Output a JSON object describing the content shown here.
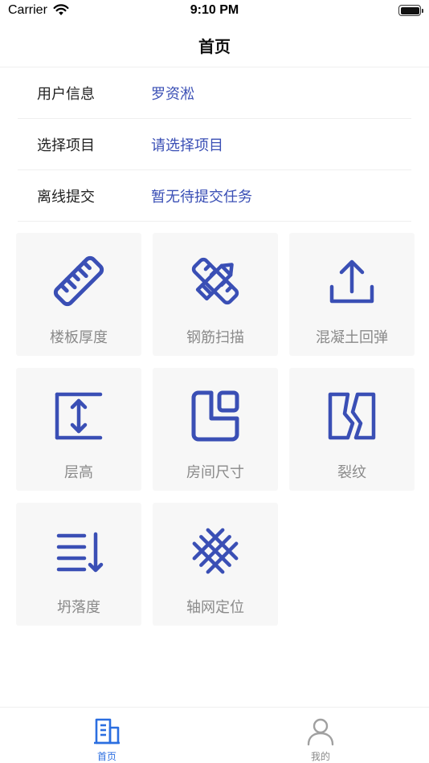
{
  "status_bar": {
    "carrier": "Carrier",
    "time": "9:10 PM"
  },
  "nav": {
    "title": "首页"
  },
  "info": [
    {
      "label": "用户信息",
      "value": "罗资淞"
    },
    {
      "label": "选择项目",
      "value": "请选择项目"
    },
    {
      "label": "离线提交",
      "value": "暂无待提交任务"
    }
  ],
  "tiles": [
    {
      "label": "楼板厚度",
      "icon": "ruler-icon"
    },
    {
      "label": "钢筋扫描",
      "icon": "pencil-ruler-icon"
    },
    {
      "label": "混凝土回弹",
      "icon": "upload-icon"
    },
    {
      "label": "层高",
      "icon": "height-arrow-icon"
    },
    {
      "label": "房间尺寸",
      "icon": "room-layout-icon"
    },
    {
      "label": "裂纹",
      "icon": "crack-icon"
    },
    {
      "label": "坍落度",
      "icon": "slump-list-icon"
    },
    {
      "label": "轴网定位",
      "icon": "grid-mesh-icon"
    }
  ],
  "tabs": [
    {
      "label": "首页",
      "icon": "building-icon",
      "active": true
    },
    {
      "label": "我的",
      "icon": "user-icon",
      "active": false
    }
  ],
  "colors": {
    "accent": "#3a4fb5",
    "tab_active": "#2b6ee0",
    "tile_bg": "#f7f7f7",
    "label_gray": "#8a8a8a"
  }
}
